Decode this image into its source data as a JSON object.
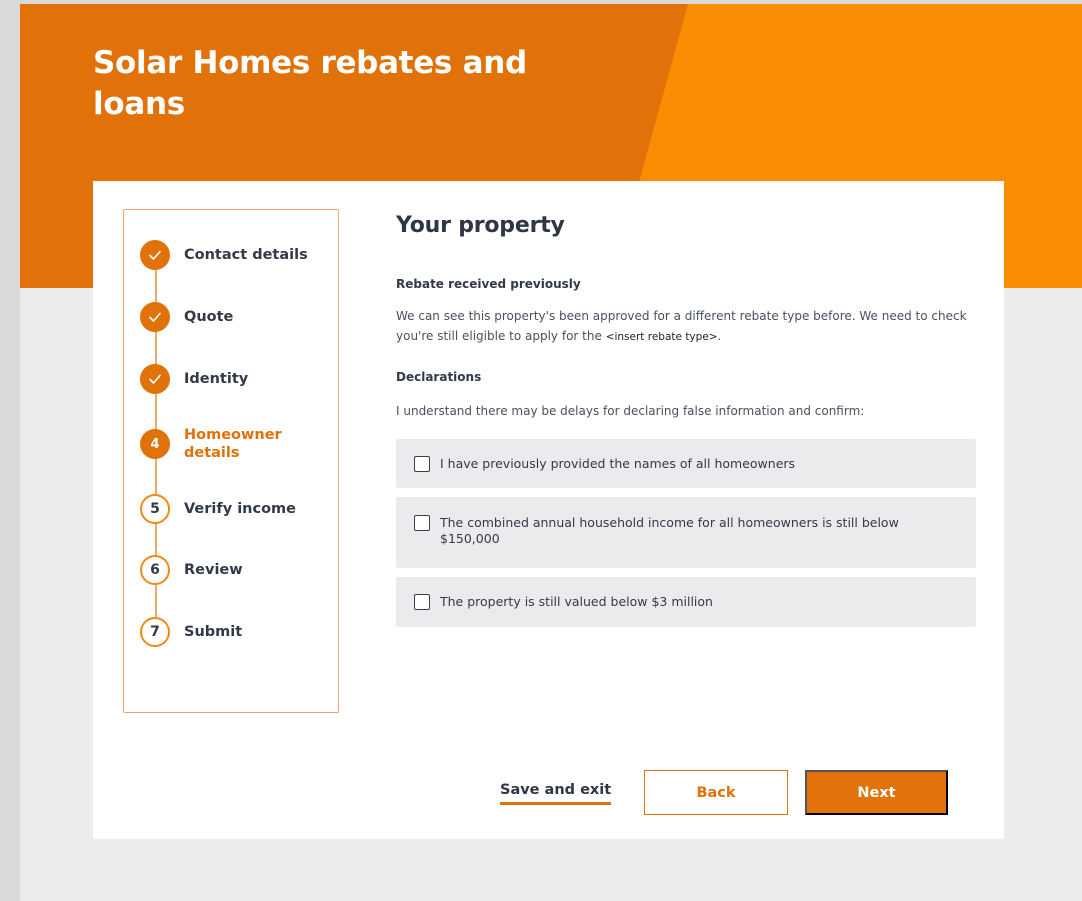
{
  "header": {
    "title": "Solar Homes rebates and loans"
  },
  "steps": [
    {
      "label": "Contact details",
      "state": "done",
      "marker": "check-icon"
    },
    {
      "label": "Quote",
      "state": "done",
      "marker": "check-icon"
    },
    {
      "label": "Identity",
      "state": "done",
      "marker": "check-icon"
    },
    {
      "label": "Homeowner details",
      "state": "current",
      "number": "4"
    },
    {
      "label": "Verify income",
      "state": "todo",
      "number": "5"
    },
    {
      "label": "Review",
      "state": "todo",
      "number": "6"
    },
    {
      "label": "Submit",
      "state": "todo",
      "number": "7"
    }
  ],
  "main": {
    "title": "Your property",
    "rebate_heading": "Rebate received previously",
    "rebate_text": "We can see this property's been approved for a different rebate type before. We need to check you're still eligible to apply for the",
    "rebate_placeholder": "<insert rebate type>.",
    "declarations_heading": "Declarations",
    "declarations_intro": "I understand there may be delays for declaring false information and confirm:",
    "checkboxes": [
      {
        "label": "I have previously provided the names of all homeowners",
        "checked": false
      },
      {
        "label": "The combined annual household income for all homeowners is still below $150,000",
        "checked": false
      },
      {
        "label": "The property is still valued below $3 million",
        "checked": false
      }
    ]
  },
  "actions": {
    "save_exit": "Save and exit",
    "back": "Back",
    "next": "Next"
  },
  "colors": {
    "accent": "#e07209",
    "accent_light": "#fb8d05",
    "background": "#ececed"
  }
}
